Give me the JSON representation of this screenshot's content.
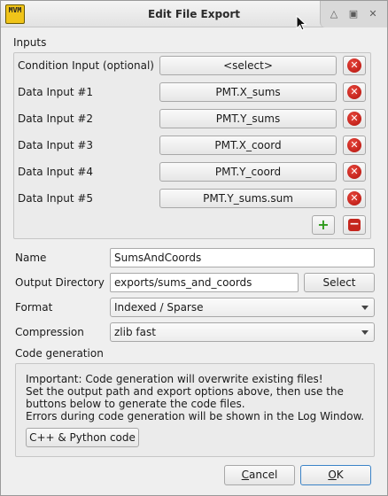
{
  "window": {
    "title": "Edit File Export",
    "app_icon_label": "MVM",
    "controls": {
      "shade_icon": "up-triangle-icon",
      "maximize_icon": "square-icon",
      "close_icon": "x-icon"
    }
  },
  "inputs": {
    "group_label": "Inputs",
    "rows": [
      {
        "label": "Condition Input (optional)",
        "value": "<select>"
      },
      {
        "label": "Data Input #1",
        "value": "PMT.X_sums"
      },
      {
        "label": "Data Input #2",
        "value": "PMT.Y_sums"
      },
      {
        "label": "Data Input #3",
        "value": "PMT.X_coord"
      },
      {
        "label": "Data Input #4",
        "value": "PMT.Y_coord"
      },
      {
        "label": "Data Input #5",
        "value": "PMT.Y_sums.sum"
      }
    ],
    "add_icon": "plus-icon",
    "remove_icon": "minus-icon"
  },
  "form": {
    "name_label": "Name",
    "name_value": "SumsAndCoords",
    "output_dir_label": "Output Directory",
    "output_dir_value": "exports/sums_and_coords",
    "select_button": "Select",
    "format_label": "Format",
    "format_value": "Indexed / Sparse",
    "compression_label": "Compression",
    "compression_value": "zlib fast"
  },
  "codegen": {
    "group_label": "Code generation",
    "lines": [
      "Important: Code generation will overwrite existing files!",
      "Set the output path and export options above, then use the",
      "buttons below to generate the code files.",
      "Errors during code generation will be shown in the Log Window."
    ],
    "button": "C++ & Python code"
  },
  "dialog": {
    "cancel_prefix": "",
    "cancel_mnemonic": "C",
    "cancel_rest": "ancel",
    "ok_mnemonic": "O",
    "ok_rest": "K"
  },
  "colors": {
    "delete_red": "#c5261d",
    "add_green": "#2e9a1c",
    "focus_blue": "#3b83c7"
  }
}
